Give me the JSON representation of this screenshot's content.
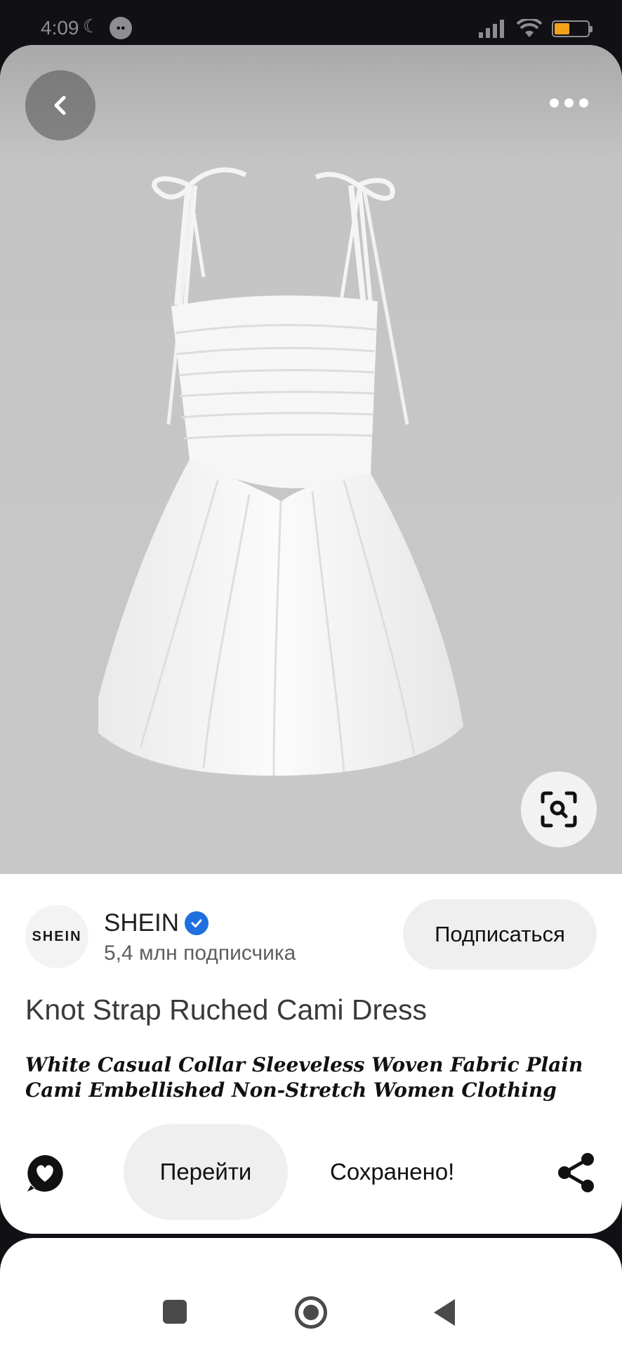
{
  "status_bar": {
    "time": "4:09",
    "battery_level": "40%"
  },
  "icons": {
    "back": "chevron-left-icon",
    "more": "more-horizontal-icon",
    "visual_search": "visual-search-icon",
    "verified": "verified-badge-icon",
    "reaction": "heart-bubble-icon",
    "share": "share-icon"
  },
  "colors": {
    "verified": "#1f6fde",
    "hero_background": "#c7c7c7",
    "button_background": "#efefef"
  },
  "creator": {
    "avatar_text": "SHEIN",
    "name": "SHEIN",
    "followers": "5,4 млн подписчика",
    "follow_label": "Подписаться"
  },
  "pin": {
    "title": "Knot Strap Ruched Cami Dress",
    "description": "White Casual Collar Sleeveless Woven Fabric Plain Cami Embellished Non-Stretch  Women Clothing"
  },
  "actions": {
    "visit_label": "Перейти",
    "saved_label": "Сохранено!"
  }
}
